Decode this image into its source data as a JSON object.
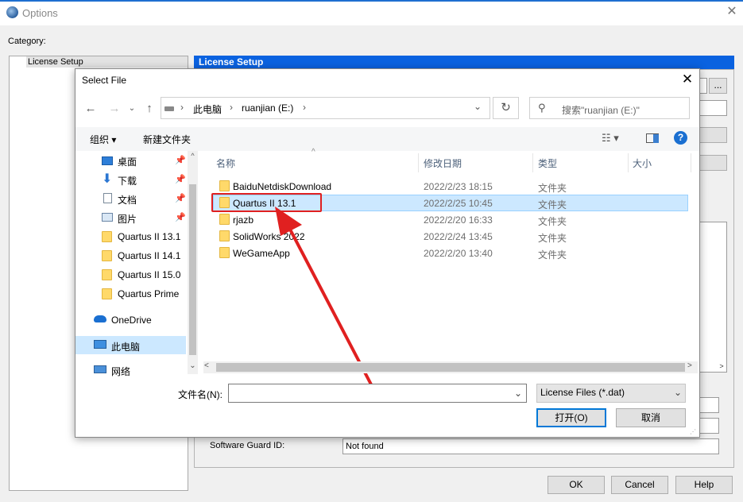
{
  "options_window": {
    "title": "Options",
    "category_label": "Category:",
    "category_item": "License Setup",
    "panel_header": "License Setup",
    "guard_label": "Software Guard ID:",
    "guard_value": "Not found",
    "browse_label": "...",
    "ok_label": "OK",
    "cancel_label": "Cancel",
    "help_label": "Help"
  },
  "dialog": {
    "title": "Select File",
    "breadcrumb": [
      "此电脑",
      "ruanjian (E:)"
    ],
    "search_placeholder": "搜索\"ruanjian (E:)\"",
    "toolbar": {
      "organize": "组织 ▾",
      "new_folder": "新建文件夹"
    },
    "nav_items": [
      {
        "label": "桌面",
        "icon": "desktop-icon",
        "pinned": true
      },
      {
        "label": "下载",
        "icon": "download-icon",
        "pinned": true
      },
      {
        "label": "文档",
        "icon": "document-icon",
        "pinned": true
      },
      {
        "label": "图片",
        "icon": "picture-icon",
        "pinned": true
      },
      {
        "label": "Quartus II 13.1",
        "icon": "folder-icon"
      },
      {
        "label": "Quartus II 14.1",
        "icon": "folder-icon"
      },
      {
        "label": "Quartus II 15.0",
        "icon": "folder-icon"
      },
      {
        "label": "Quartus Prime",
        "icon": "folder-icon"
      },
      {
        "label": "OneDrive",
        "icon": "cloud-icon"
      },
      {
        "label": "此电脑",
        "icon": "computer-icon",
        "selected": true
      },
      {
        "label": "网络",
        "icon": "network-icon"
      }
    ],
    "columns": [
      "名称",
      "修改日期",
      "类型",
      "大小"
    ],
    "files": [
      {
        "name": "BaiduNetdiskDownload",
        "date": "2022/2/23 18:15",
        "type": "文件夹"
      },
      {
        "name": "Quartus II 13.1",
        "date": "2022/2/25 10:45",
        "type": "文件夹",
        "selected": true
      },
      {
        "name": "rjazb",
        "date": "2022/2/20 16:33",
        "type": "文件夹"
      },
      {
        "name": "SolidWorks 2022",
        "date": "2022/2/24 13:45",
        "type": "文件夹"
      },
      {
        "name": "WeGameApp",
        "date": "2022/2/20 13:40",
        "type": "文件夹"
      }
    ],
    "filename_label": "文件名(N):",
    "filename_value": "",
    "filter": "License Files (*.dat)",
    "open_label": "打开(O)",
    "cancel_label": "取消"
  },
  "colors": {
    "accent": "#0a62e0",
    "selection": "#cce8ff",
    "annotation": "#e02020"
  }
}
